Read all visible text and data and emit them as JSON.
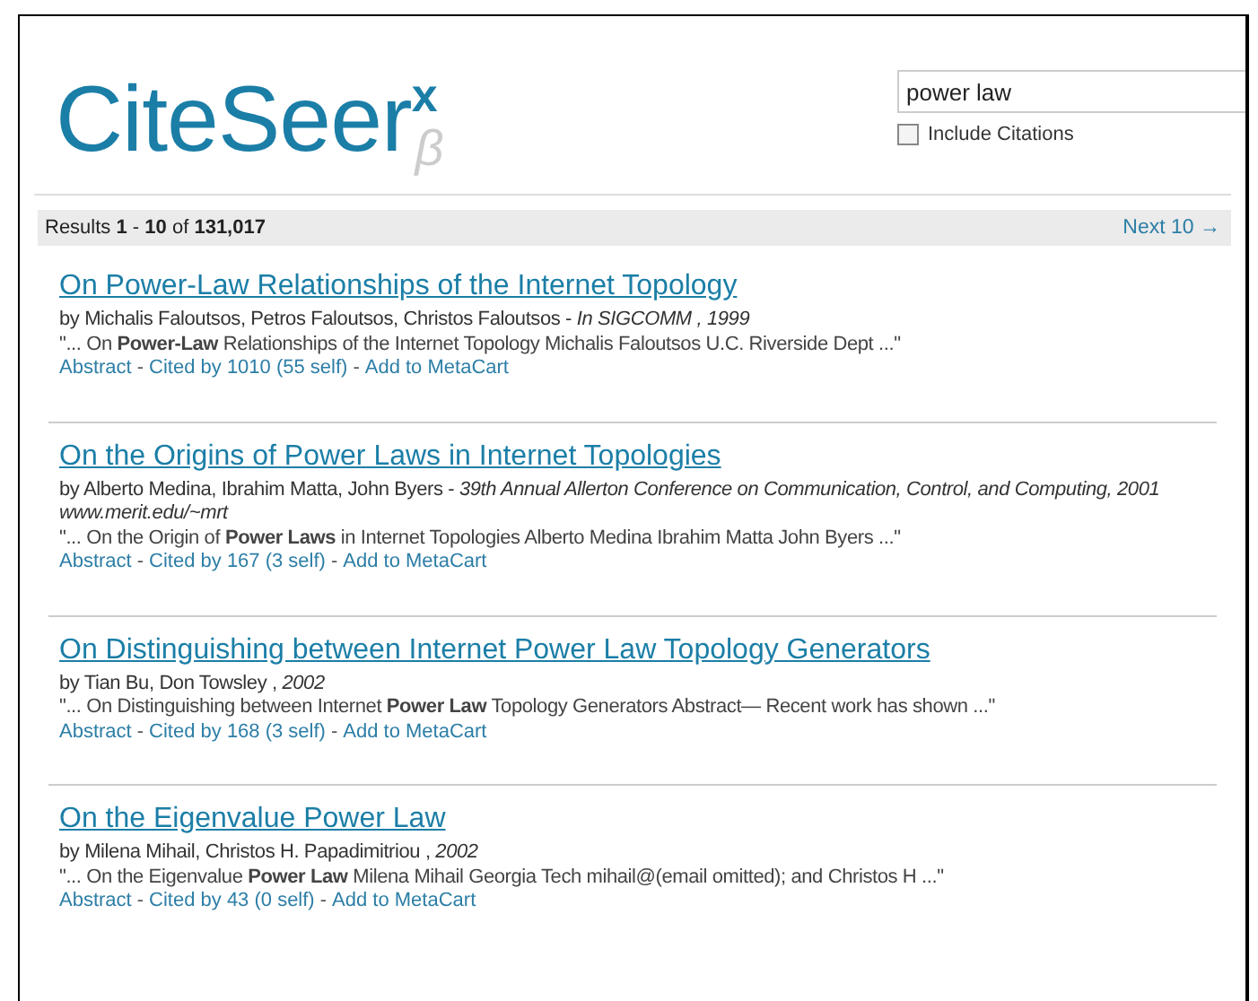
{
  "logo": "CiteSeer$^{x}$$_{β}$",
  "search": {
    "value": "power law",
    "include_citations": {
      "label": "Include Citations",
      "checked": false
    }
  },
  "results_bar": {
    "summary": "Results **1** - **10** of **131,017**",
    "next": "Next 10 →"
  },
  "results": [
    {
      "title": "On Power-Law Relationships of the Internet Topology",
      "authors": "by Michalis Faloutsos, Petros Faloutsos, Christos Faloutsos - *In SIGCOMM , 1999*",
      "snippet": "\"... On **Power-Law** Relationships of the Internet Topology Michalis Faloutsos U.C. Riverside Dept ...\"",
      "links": [
        "Abstract",
        "Cited by 1010 (55 self)",
        "Add to MetaCart"
      ]
    },
    {
      "title": "On the Origins of Power Laws in Internet Topologies",
      "authors": "by Alberto Medina, Ibrahim Matta, John Byers - *39th Annual Allerton Conference on Communication, Control, and Computing, 2001*",
      "url": "www.merit.edu/~mrt",
      "snippet": "\"... On the Origin of **Power Laws** in Internet Topologies Alberto Medina Ibrahim Matta John Byers ...\"",
      "links": [
        "Abstract",
        "Cited by 167 (3 self)",
        "Add to MetaCart"
      ]
    },
    {
      "title": "On Distinguishing between Internet Power Law Topology Generators",
      "authors": "by Tian Bu, Don Towsley , *2002*",
      "snippet": "\"... On Distinguishing between Internet **Power Law** Topology Generators Abstract— Recent work has shown ...\"",
      "links": [
        "Abstract",
        "Cited by 168 (3 self)",
        "Add to MetaCart"
      ]
    },
    {
      "title": "On the Eigenvalue Power Law",
      "authors": "by Milena Mihail, Christos H. Papadimitriou , *2002*",
      "snippet": "\"... On the Eigenvalue **Power Law** Milena Mihail Georgia Tech mihail@(email omitted); and Christos H ...\"",
      "links": [
        "Abstract",
        "Cited by 43 (0 self)",
        "Add to MetaCart"
      ]
    }
  ],
  "link_separator": "-"
}
